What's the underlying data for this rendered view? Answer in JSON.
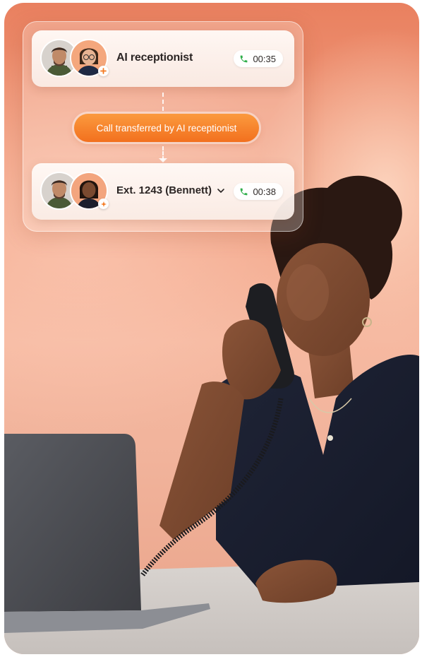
{
  "call_top": {
    "caller_name": "AI receptionist",
    "duration": "00:35"
  },
  "transfer_notice": "Call transferred by AI receptionist",
  "call_bottom": {
    "caller_name": "Ext. 1243 (Bennett)",
    "duration": "00:38"
  },
  "colors": {
    "accent": "#f47a22",
    "phone_icon": "#2fae4a",
    "background_warm": "#f2a386"
  },
  "icons": [
    "phone-icon",
    "chevron-down-icon",
    "plus-badge-icon",
    "ai-badge-icon"
  ]
}
